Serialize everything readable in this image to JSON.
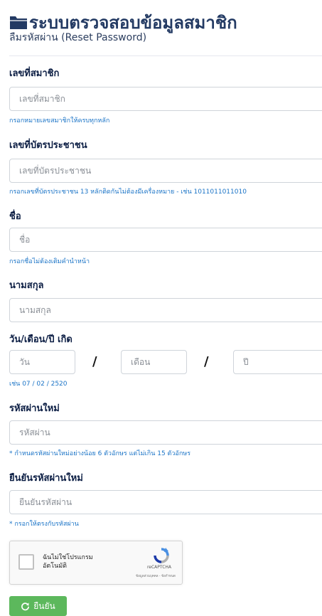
{
  "header": {
    "title": "ระบบตรวจสอบข้อมูลสมาชิก",
    "subtitle": "ลืมรหัสผ่าน (Reset Password)"
  },
  "form": {
    "member_no": {
      "label": "เลขที่สมาชิก",
      "placeholder": "เลขที่สมาชิก",
      "help": "กรอกหมายเลขสมาชิกให้ครบทุกหลัก"
    },
    "id_card": {
      "label": "เลขที่บัตรประชาชน",
      "placeholder": "เลขที่บัตรประชาชน",
      "help": "กรอกเลขที่บัตรประชาชน 13 หลักติดกันไม่ต้องมีเครื่องหมาย - เช่น 1011011011010"
    },
    "first_name": {
      "label": "ชื่อ",
      "placeholder": "ชื่อ",
      "help": "กรอกชื่อไม่ต้องเติมคำนำหน้า"
    },
    "last_name": {
      "label": "นามสกุล",
      "placeholder": "นามสกุล"
    },
    "birth_date": {
      "label": "วัน/เดือน/ปี เกิด",
      "day_placeholder": "วัน",
      "month_placeholder": "เดือน",
      "year_placeholder": "ปี",
      "separator": "/",
      "help": "เช่น 07 / 02 / 2520"
    },
    "new_password": {
      "label": "รหัสผ่านใหม่",
      "placeholder": "รหัสผ่าน",
      "help": "* กำหนดรหัสผ่านใหม่อย่างน้อย 6 ตัวอักษร แต่ไม่เกิน 15 ตัวอักษร"
    },
    "confirm_password": {
      "label": "ยืนยันรหัสผ่านใหม่",
      "placeholder": "ยืนยันรหัสผ่าน",
      "help": "* กรอกให้ตรงกับรหัสผ่าน"
    }
  },
  "captcha": {
    "label": "ฉันไม่ใช่โปรแกรมอัตโนมัติ",
    "brand": "reCAPTCHA",
    "links": "ข้อมูลส่วนบุคคล - ข้อกำหนด"
  },
  "submit_label": "ยืนยัน",
  "colors": {
    "title": "#233a63",
    "help_text": "#1b74c7",
    "submit_bg": "#5cb85c"
  }
}
